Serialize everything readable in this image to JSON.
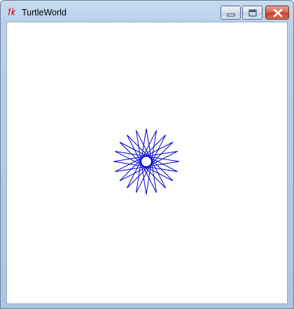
{
  "window": {
    "title": "TurtleWorld",
    "icon": "tk-feather-icon",
    "controls": [
      "minimize-icon",
      "maximize-icon",
      "close-icon"
    ]
  },
  "canvas": {
    "background": "#ffffff",
    "pen_color": "#0000cc",
    "figure": "star",
    "star_points": 20
  }
}
